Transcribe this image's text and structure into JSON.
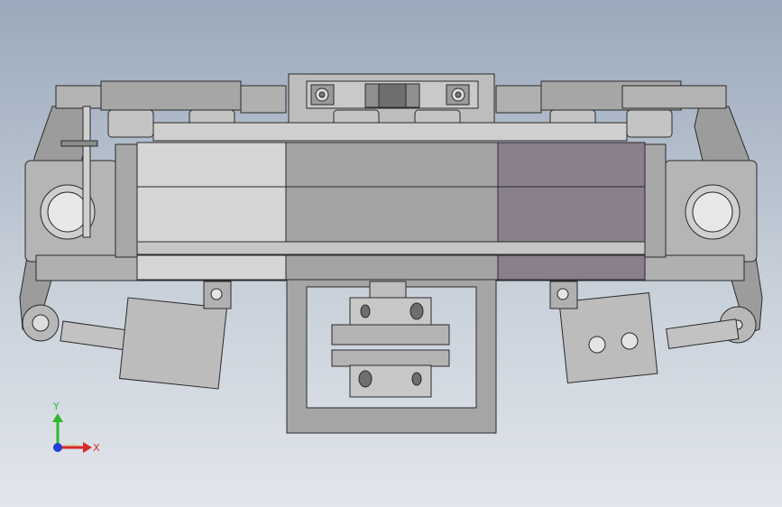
{
  "triad": {
    "y_label": "Y",
    "x_label": "X",
    "y_color": "#2fb82f",
    "x_color": "#d42a2a",
    "z_color": "#1f3fd6"
  },
  "colors": {
    "bg_top": "#9aa9bb",
    "bg_bottom": "#e2e6ec",
    "steel": "#a8a8a8",
    "panel_light": "#d6d6d6",
    "panel_mid": "#a3a3a3",
    "panel_purple": "#8a7f8c",
    "outline": "#2a2a2a"
  },
  "icons": [
    "coordinate-triad-icon"
  ]
}
